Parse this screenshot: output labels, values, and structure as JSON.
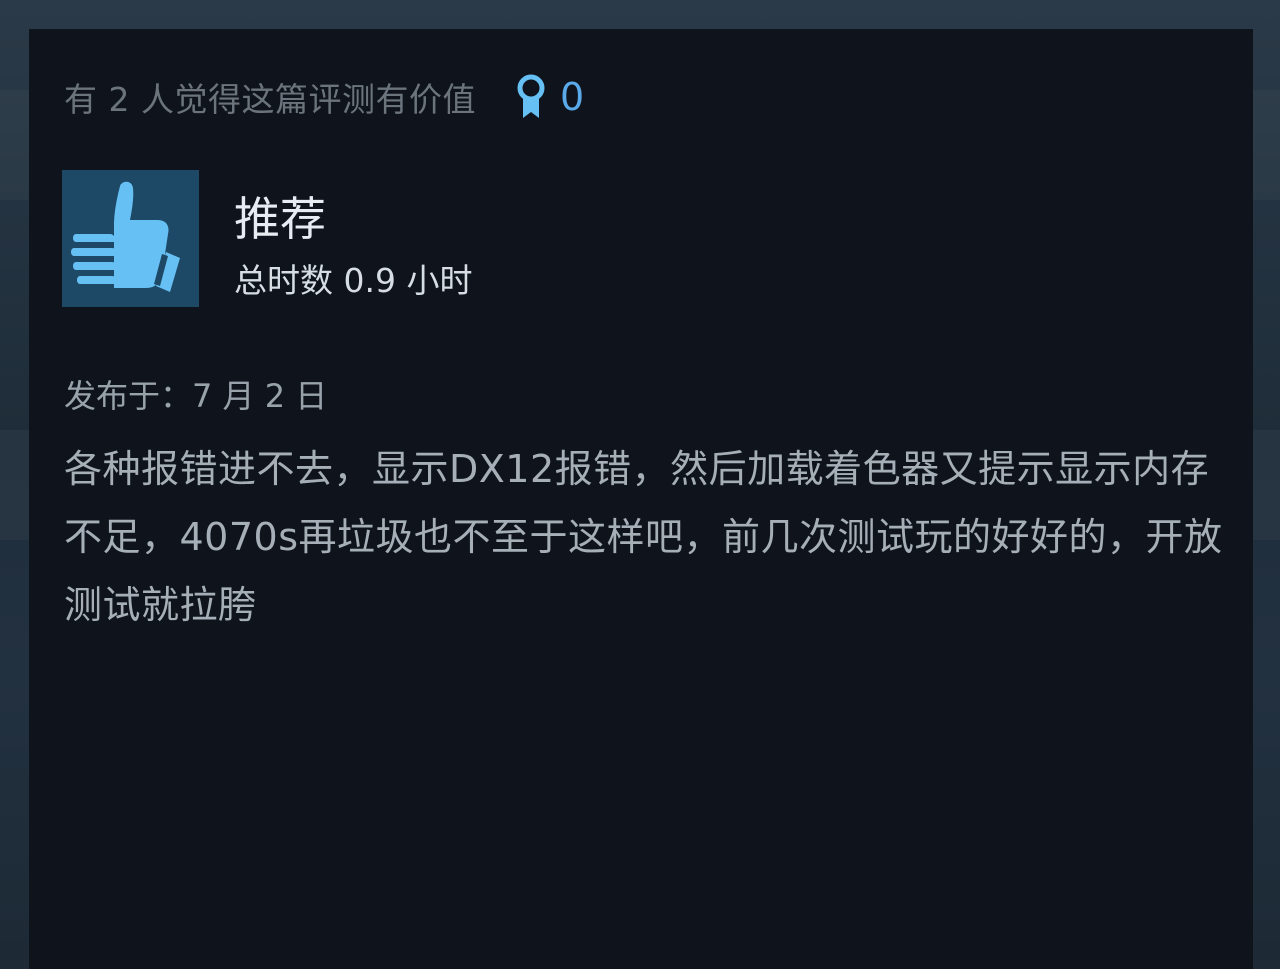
{
  "review": {
    "helpful_text": "有 2 人觉得这篇评测有价值",
    "award_count": "0",
    "verdict": "推荐",
    "hours": "总时数 0.9 小时",
    "posted": "发布于：7 月 2 日",
    "body": "各种报错进不去，显示DX12报错，然后加载着色器又提示显示内存不足，4070s再垃圾也不至于这样吧，前几次测试玩的好好的，开放测试就拉胯"
  },
  "icons": {
    "award": "award-ribbon-icon",
    "verdict": "thumbs-up-icon"
  },
  "colors": {
    "card_background": "#0f141c",
    "accent_blue": "#5aa9e8",
    "thumb_blue": "#66c0f4",
    "verdict_box": "#1d4866"
  }
}
